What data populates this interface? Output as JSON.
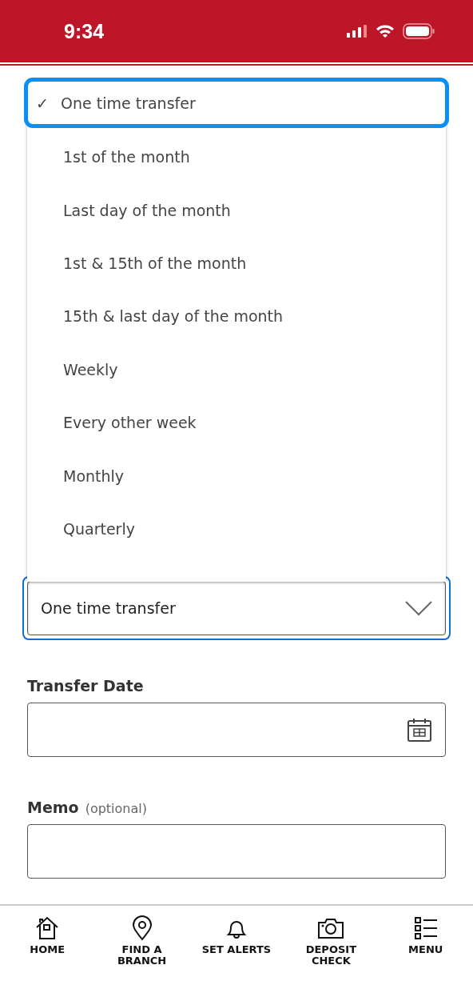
{
  "status_bar": {
    "time": "9:34"
  },
  "frequency_select": {
    "value": "One time transfer",
    "expanded": true
  },
  "frequency_options": [
    {
      "label": "One time transfer",
      "selected": true
    },
    {
      "label": "1st of the month",
      "selected": false
    },
    {
      "label": "Last day of the month",
      "selected": false
    },
    {
      "label": "1st & 15th of the month",
      "selected": false
    },
    {
      "label": "15th & last day of the month",
      "selected": false
    },
    {
      "label": "Weekly",
      "selected": false
    },
    {
      "label": "Every other week",
      "selected": false
    },
    {
      "label": "Monthly",
      "selected": false
    },
    {
      "label": "Quarterly",
      "selected": false
    }
  ],
  "check_mark": "✓",
  "transfer_date": {
    "label": "Transfer Date"
  },
  "memo": {
    "label": "Memo",
    "hint": "(optional)"
  },
  "bottom_nav": [
    {
      "kind": "home",
      "label": "HOME"
    },
    {
      "kind": "pin",
      "label": "FIND A BRANCH"
    },
    {
      "kind": "bell",
      "label": "SET ALERTS"
    },
    {
      "kind": "camera",
      "label": "DEPOSIT CHECK"
    },
    {
      "kind": "list",
      "label": "MENU"
    }
  ]
}
